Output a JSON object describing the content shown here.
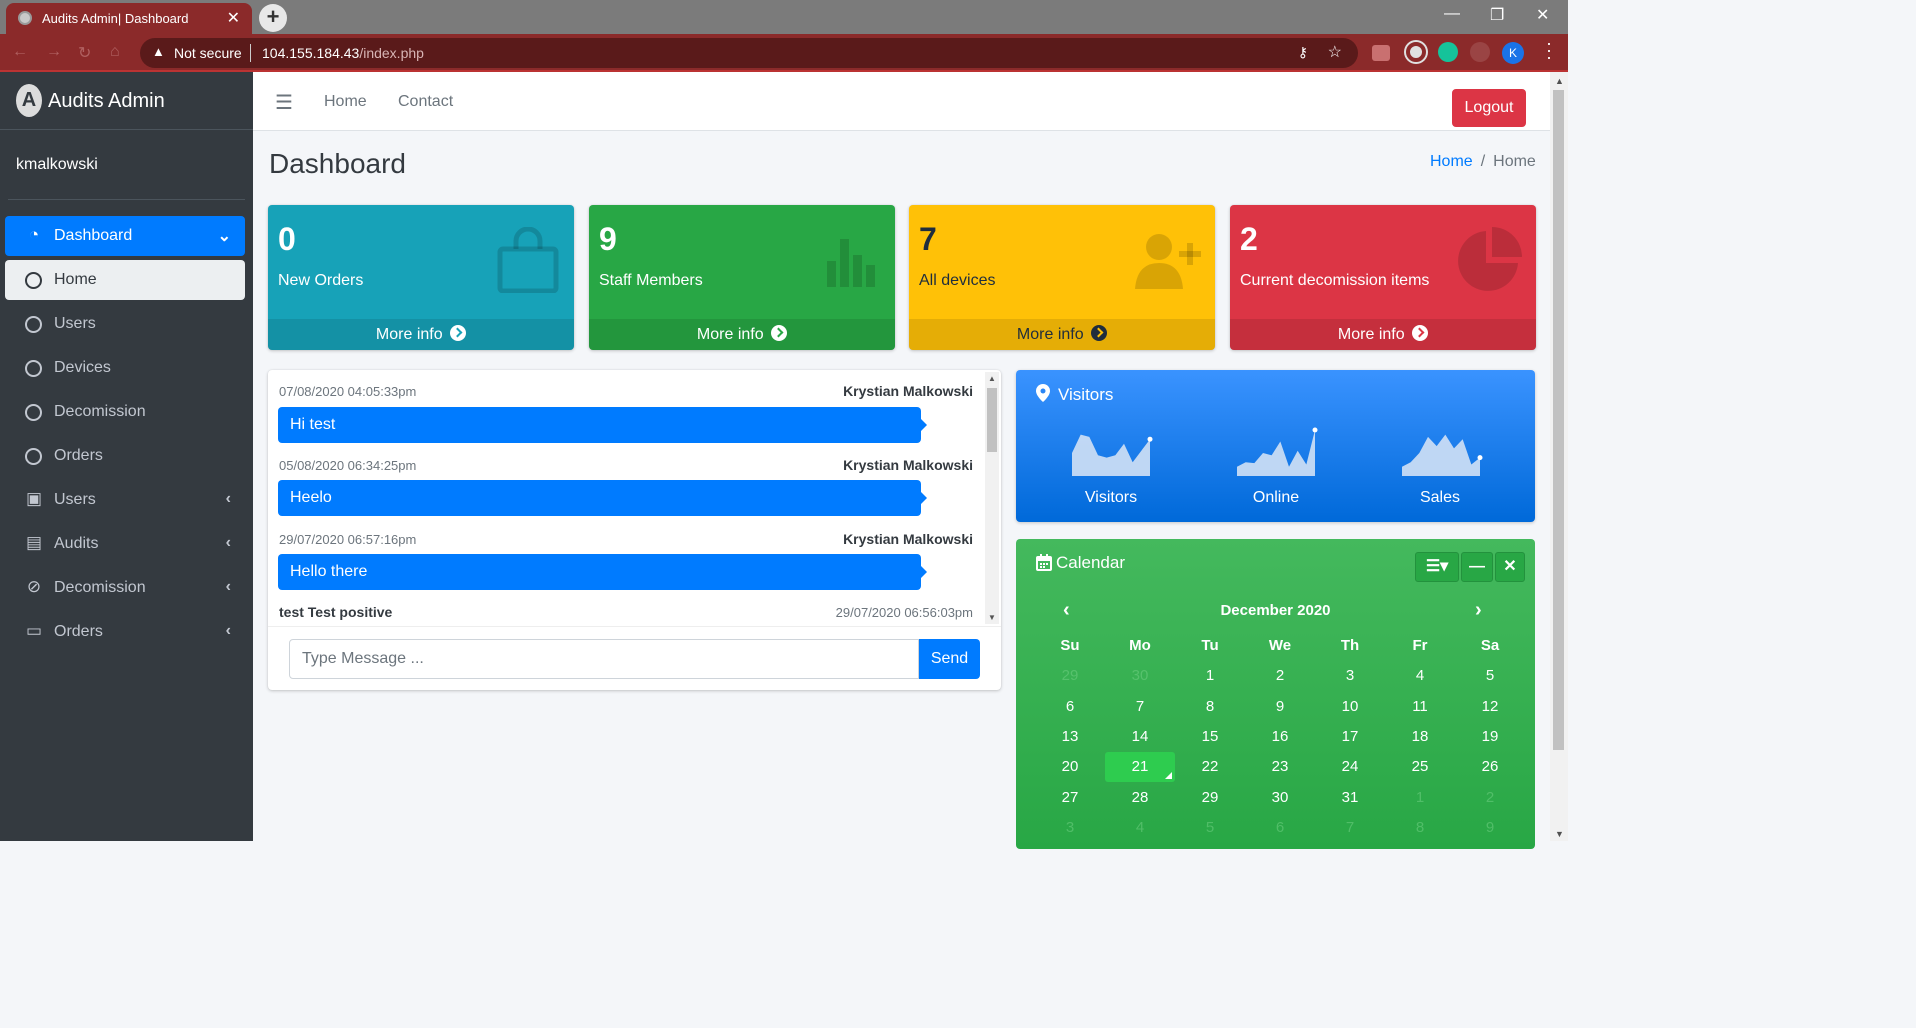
{
  "browser": {
    "tab_title": "Audits Admin| Dashboard",
    "tab_close": "✕",
    "new_tab": "+",
    "security_label": "Not secure",
    "url_host": "104.155.184.43",
    "url_path": "/index.php",
    "profile_initial": "K",
    "window_controls": {
      "minimize": "—",
      "restore": "❐",
      "close": "✕"
    }
  },
  "sidebar": {
    "brand": "Audits Admin",
    "brand_logo_letter": "A",
    "user": "kmalkowski",
    "items": [
      {
        "label": "Dashboard",
        "icon": "tachometer-icon",
        "state": "active",
        "arrow": "⌄"
      },
      {
        "label": "Home",
        "icon": "circle-icon",
        "state": "sub-active",
        "arrow": ""
      },
      {
        "label": "Users",
        "icon": "circle-icon",
        "state": "",
        "arrow": ""
      },
      {
        "label": "Devices",
        "icon": "circle-icon",
        "state": "",
        "arrow": ""
      },
      {
        "label": "Decomission",
        "icon": "circle-icon",
        "state": "",
        "arrow": ""
      },
      {
        "label": "Orders",
        "icon": "circle-icon",
        "state": "",
        "arrow": ""
      },
      {
        "label": "Users",
        "icon": "id-badge-icon",
        "state": "",
        "arrow": "‹"
      },
      {
        "label": "Audits",
        "icon": "briefcase-icon",
        "state": "",
        "arrow": "‹"
      },
      {
        "label": "Decomission",
        "icon": "ban-icon",
        "state": "",
        "arrow": "‹"
      },
      {
        "label": "Orders",
        "icon": "credit-card-icon",
        "state": "",
        "arrow": "‹"
      }
    ]
  },
  "header": {
    "links": [
      "Home",
      "Contact"
    ],
    "logout": "Logout"
  },
  "content": {
    "title": "Dashboard",
    "breadcrumb": {
      "link": "Home",
      "current": "Home"
    }
  },
  "stat_boxes": [
    {
      "count": "0",
      "label": "New Orders",
      "footer": "More info",
      "color": "#17a2b8",
      "icon": "shopping-bag-icon"
    },
    {
      "count": "9",
      "label": "Staff Members",
      "footer": "More info",
      "color": "#28a745",
      "icon": "bar-chart-icon"
    },
    {
      "count": "7",
      "label": "All devices",
      "footer": "More info",
      "color": "#ffc107",
      "icon": "user-plus-icon"
    },
    {
      "count": "2",
      "label": "Current decomission items",
      "footer": "More info",
      "color": "#dc3545",
      "icon": "pie-chart-icon"
    }
  ],
  "chat": {
    "messages": [
      {
        "time": "07/08/2020 04:05:33pm",
        "name": "Krystian Malkowski",
        "text": "Hi test"
      },
      {
        "time": "05/08/2020 06:34:25pm",
        "name": "Krystian Malkowski",
        "text": "Heelo"
      },
      {
        "time": "29/07/2020 06:57:16pm",
        "name": "Krystian Malkowski",
        "text": "Hello there"
      }
    ],
    "partial_message": {
      "name": "test Test positive",
      "time": "29/07/2020 06:56:03pm"
    },
    "input_placeholder": "Type Message ...",
    "send": "Send"
  },
  "visitors": {
    "title": "Visitors",
    "sparklines": [
      {
        "label": "Visitors",
        "values": [
          50,
          90,
          85,
          45,
          40,
          45,
          70,
          30,
          55,
          80
        ]
      },
      {
        "label": "Online",
        "values": [
          20,
          30,
          28,
          50,
          45,
          75,
          20,
          55,
          25,
          100
        ]
      },
      {
        "label": "Sales",
        "values": [
          20,
          30,
          50,
          85,
          65,
          90,
          60,
          80,
          25,
          40
        ]
      }
    ]
  },
  "calendar": {
    "title": "Calendar",
    "month": "December 2020",
    "prev": "‹",
    "next": "›",
    "weekdays": [
      "Su",
      "Mo",
      "Tu",
      "We",
      "Th",
      "Fr",
      "Sa"
    ],
    "weeks": [
      [
        "29",
        "30",
        "1",
        "2",
        "3",
        "4",
        "5"
      ],
      [
        "6",
        "7",
        "8",
        "9",
        "10",
        "11",
        "12"
      ],
      [
        "13",
        "14",
        "15",
        "16",
        "17",
        "18",
        "19"
      ],
      [
        "20",
        "21",
        "22",
        "23",
        "24",
        "25",
        "26"
      ],
      [
        "27",
        "28",
        "29",
        "30",
        "31",
        "1",
        "2"
      ],
      [
        "3",
        "4",
        "5",
        "6",
        "7",
        "8",
        "9"
      ]
    ],
    "today": "21"
  }
}
